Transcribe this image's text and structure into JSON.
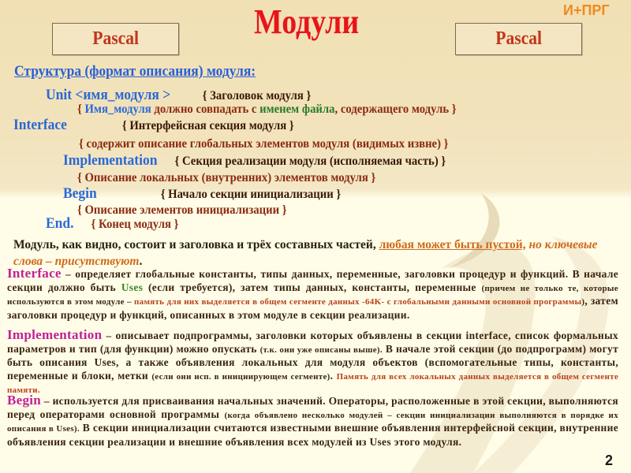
{
  "header": {
    "title": "Модули",
    "brand": "И+ПРГ",
    "left_box": "Pascal",
    "right_box": "Pascal"
  },
  "structure": {
    "heading": "Структура (формат описания) модуля:",
    "lines": [
      {
        "keyword": "Unit <имя_модуля >",
        "comment": "{ Заголовок модуля }"
      },
      {
        "parts": [
          "{ ",
          "Имя_модуля",
          " должно совпадать с ",
          "именем файла",
          ", содержащего модуль }"
        ]
      },
      {
        "keyword": "Interface",
        "comment": "{ Интерфейсная секция  модуля }"
      },
      {
        "comment": "{ содержит описание глобальных элементов модуля (видимых извне) }"
      },
      {
        "keyword": "Implementation",
        "comment": "{ Секция реализации модуля (исполняемая часть) }"
      },
      {
        "comment": "{ Описание локальных (внутренних) элементов модуля }"
      },
      {
        "keyword": "Begin",
        "comment": "{ Начало секции инициализации }"
      },
      {
        "comment": "{ Описание элементов инициализации }"
      },
      {
        "keyword": "End.",
        "comment": "{ Конец модуля }"
      }
    ]
  },
  "summary": {
    "text": "Модуль, как видно, состоит и заголовка и трёх составных частей, ",
    "highlight": "любая может быть пустой,",
    "italic": " но ключевые слова – присутствуют",
    "end": "."
  },
  "sections": {
    "interface": {
      "name": "Interface",
      "t1": " – определяет глобальные константы, типы данных, переменные, заголовки процедур и функций. В начале секции должно быть ",
      "uses": "Uses",
      "t2": " (если требуется), затем типы данных, константы, переменные ",
      "small1": "(причем не только те, которые используются в этом модуле – ",
      "red1": "память для них выделяется в общем сегменте данных -64K- с глобальными данными основной программы",
      "small2": ")",
      "t3": ", затем заголовки процедур и функций, описанных в этом модуле в секции реализации."
    },
    "implementation": {
      "name": "Implementation",
      "t1": " – описывает подпрограммы, заголовки которых объявлены в секции interface, список формальных параметров и тип (для функции) можно опускать ",
      "small1": "(т.к. они уже описаны выше).",
      "t2": "  В начале  этой секции (до подпрограмм) могут быть описания Uses, а также объявления локальных для модуля объектов (вспомогательные типы, константы, переменные и блоки, метки ",
      "small2": "(если они исп. в инициирующем сегменте)",
      "t3": ". ",
      "red1": "Память для всех локальных данных выделяется в  общем сегменте памяти."
    },
    "begin": {
      "name": "Begin",
      "t1": " – используется для присваивания начальных значений. Операторы, расположенные в этой секции, выполняются перед операторами основной программы ",
      "small1": "(когда объявлено несколько модулей – секции инициализации выполняются в порядке их описания в Uses).",
      "t2": " В секции инициализации считаются известными внешние объявления интерфейсной секции, внутренние объявления секции реализации и внешние объявления всех модулей из Uses этого модуля."
    }
  },
  "page_number": "2"
}
